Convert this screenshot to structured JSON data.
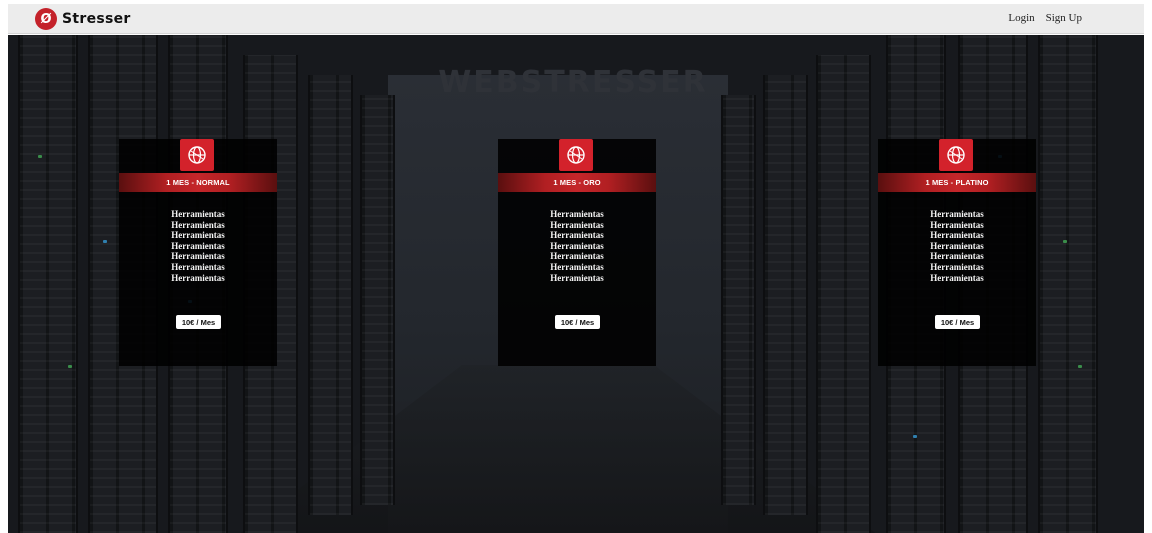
{
  "navbar": {
    "brand": "Stresser",
    "links": {
      "login": "Login",
      "signup": "Sign Up"
    }
  },
  "background": {
    "watermark": "WEBSTRESSER"
  },
  "colors": {
    "accent": "#d3222b",
    "navbar_bg": "#ececec",
    "card_bg": "#000000"
  },
  "icons": {
    "plan_icon": "globe-icon",
    "brand_icon": "shield-logo-icon"
  },
  "plans": [
    {
      "title": "1 MES - NORMAL",
      "features": [
        "Herramientas",
        "Herramientas",
        "Herramientas",
        "Herramientas",
        "Herramientas",
        "Herramientas",
        "Herramientas"
      ],
      "price": "10€ / Mes"
    },
    {
      "title": "1 MES - ORO",
      "features": [
        "Herramientas",
        "Herramientas",
        "Herramientas",
        "Herramientas",
        "Herramientas",
        "Herramientas",
        "Herramientas"
      ],
      "price": "10€ / Mes"
    },
    {
      "title": "1 MES - PLATINO",
      "features": [
        "Herramientas",
        "Herramientas",
        "Herramientas",
        "Herramientas",
        "Herramientas",
        "Herramientas",
        "Herramientas"
      ],
      "price": "10€ / Mes"
    }
  ]
}
